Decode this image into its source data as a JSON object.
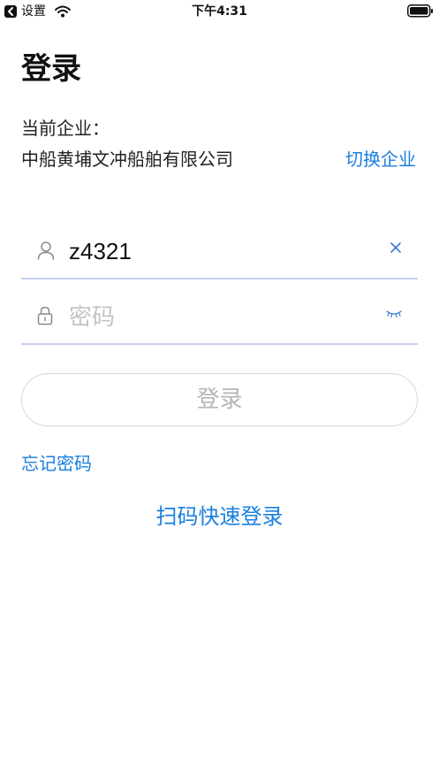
{
  "status_bar": {
    "back_app": "设置",
    "time": "下午4:31"
  },
  "page": {
    "title": "登录"
  },
  "company": {
    "label": "当前企业：",
    "name": "中船黄埔文冲船舶有限公司",
    "switch_label": "切换企业"
  },
  "form": {
    "username_value": "z4321",
    "password_placeholder": "密码",
    "login_label": "登录",
    "forgot_label": "忘记密码",
    "scan_login_label": "扫码快速登录"
  },
  "colors": {
    "accent": "#1a7fe0",
    "field_underline": "#c7cff0",
    "disabled_text": "#b5b5b5"
  },
  "icons": {
    "username": "user-icon",
    "password": "lock-icon",
    "clear": "clear-icon",
    "visibility": "eye-closed-icon"
  }
}
